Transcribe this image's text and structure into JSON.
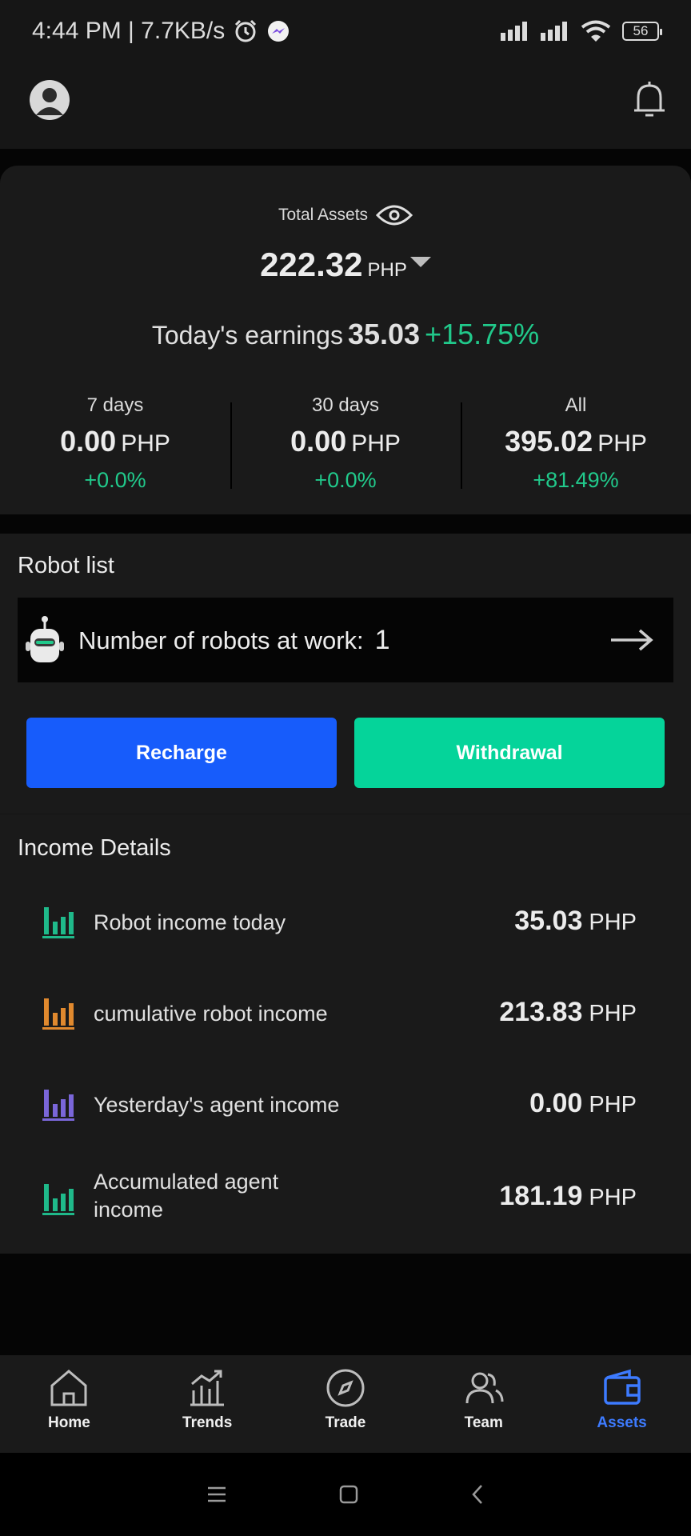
{
  "status_bar": {
    "time_speed": "4:44 PM | 7.7KB/s",
    "battery": "56"
  },
  "assets": {
    "total_label": "Total Assets",
    "total_value": "222.32",
    "currency": "PHP",
    "today_label": "Today's earnings",
    "today_value": "35.03",
    "today_change": "+15.75%",
    "periods": [
      {
        "label": "7 days",
        "value": "0.00",
        "unit": "PHP",
        "change": "+0.0%"
      },
      {
        "label": "30 days",
        "value": "0.00",
        "unit": "PHP",
        "change": "+0.0%"
      },
      {
        "label": "All",
        "value": "395.02",
        "unit": "PHP",
        "change": "+81.49%"
      }
    ]
  },
  "robots": {
    "title": "Robot list",
    "working_label": "Number of robots at work:",
    "working_count": "1"
  },
  "actions": {
    "recharge": "Recharge",
    "withdrawal": "Withdrawal"
  },
  "income": {
    "title": "Income Details",
    "items": [
      {
        "label": "Robot income today",
        "value": "35.03",
        "unit": "PHP",
        "color": "#1fb98a"
      },
      {
        "label": "cumulative robot income",
        "value": "213.83",
        "unit": "PHP",
        "color": "#e0892e"
      },
      {
        "label": "Yesterday's agent income",
        "value": "0.00",
        "unit": "PHP",
        "color": "#7a66d9"
      },
      {
        "label": "Accumulated agent income",
        "value": "181.19",
        "unit": "PHP",
        "color": "#1fb98a"
      }
    ]
  },
  "nav": {
    "items": [
      {
        "label": "Home",
        "icon": "home-icon"
      },
      {
        "label": "Trends",
        "icon": "trends-icon"
      },
      {
        "label": "Trade",
        "icon": "compass-icon"
      },
      {
        "label": "Team",
        "icon": "team-icon"
      },
      {
        "label": "Assets",
        "icon": "wallet-icon"
      }
    ],
    "active_color": "#3d7bff"
  },
  "colors": {
    "positive": "#21c98b",
    "recharge": "#175cfb",
    "withdrawal": "#05d49a"
  }
}
